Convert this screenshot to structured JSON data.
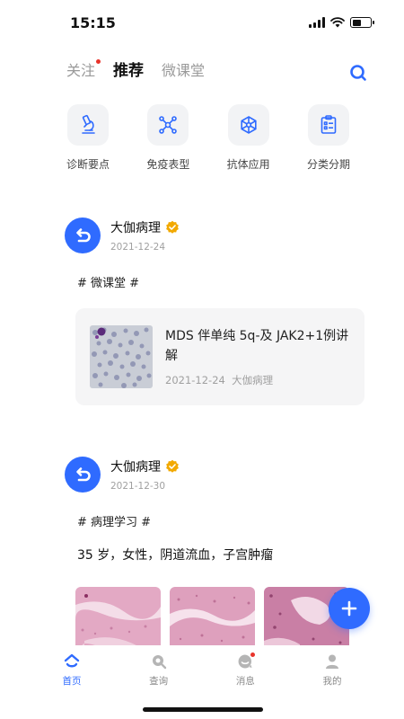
{
  "status_bar": {
    "time": "15:15"
  },
  "top_tabs": [
    {
      "label": "关注",
      "has_dot": true,
      "active": false
    },
    {
      "label": "推荐",
      "active": true
    },
    {
      "label": "微课堂",
      "active": false
    }
  ],
  "categories": [
    {
      "label": "诊断要点",
      "icon": "microscope-icon"
    },
    {
      "label": "免疫表型",
      "icon": "molecule-icon"
    },
    {
      "label": "抗体应用",
      "icon": "antibody-hexagon-icon"
    },
    {
      "label": "分类分期",
      "icon": "clipboard-list-icon"
    }
  ],
  "posts": [
    {
      "author": "大伽病理",
      "date": "2021-12-24",
      "topic": "# 微课堂 #",
      "course": {
        "title": "MDS 伴单纯 5q-及 JAK2+1例讲解",
        "meta": "2021-12-24  大伽病理"
      }
    },
    {
      "author": "大伽病理",
      "date": "2021-12-30",
      "topic": "# 病理学习 #",
      "text": "35 岁，女性，阴道流血，子宫肿瘤"
    }
  ],
  "bottom_nav": [
    {
      "label": "首页",
      "icon": "home-icon",
      "active": true
    },
    {
      "label": "查询",
      "icon": "search-icon",
      "active": false
    },
    {
      "label": "消息",
      "icon": "message-icon",
      "active": false,
      "has_dot": true
    },
    {
      "label": "我的",
      "icon": "user-icon",
      "active": false
    }
  ],
  "colors": {
    "accent": "#2f6bff",
    "badge": "#e8342b",
    "verified": "#f2a900"
  }
}
